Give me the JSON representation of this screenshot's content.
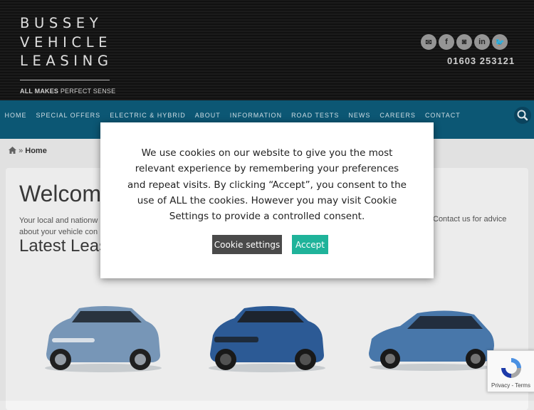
{
  "brand": {
    "lines": [
      "BUSSEY",
      "VEHICLE",
      "LEASING"
    ],
    "tagline_bold": "ALL MAKES",
    "tagline_rest": " PERFECT SENSE"
  },
  "header": {
    "social": [
      {
        "icon": "email-icon",
        "glyph": "✉"
      },
      {
        "icon": "facebook-icon",
        "glyph": "f"
      },
      {
        "icon": "instagram-icon",
        "glyph": "◙"
      },
      {
        "icon": "linkedin-icon",
        "glyph": "in"
      },
      {
        "icon": "twitter-icon",
        "glyph": "🐦"
      }
    ],
    "phone": "01603 253121"
  },
  "nav": {
    "items": [
      "HOME",
      "SPECIAL OFFERS",
      "ELECTRIC & HYBRID",
      "ABOUT",
      "INFORMATION",
      "ROAD TESTS",
      "NEWS",
      "CAREERS",
      "CONTACT"
    ]
  },
  "breadcrumb": {
    "sep": "»",
    "current": "Home"
  },
  "main": {
    "heading": "Welcom",
    "intro_line1": "Your local and nationw",
    "intro_line2": "about your vehicle con",
    "intro_right": "Contact us for advice",
    "latest_heading": "Latest Leas"
  },
  "cookie": {
    "message": "We use cookies on our website to give you the most relevant experience by remembering your preferences and repeat visits. By clicking “Accept”, you consent to the use of ALL the cookies. However you may visit Cookie Settings to provide a controlled consent.",
    "settings_label": "Cookie settings",
    "accept_label": "Accept"
  },
  "recaptcha": {
    "label": "Privacy - Terms"
  },
  "colors": {
    "nav_bg": "#0d5a78",
    "accept": "#1fb39a",
    "settings": "#4a4a4a",
    "car_blue": "#6f93b8"
  }
}
